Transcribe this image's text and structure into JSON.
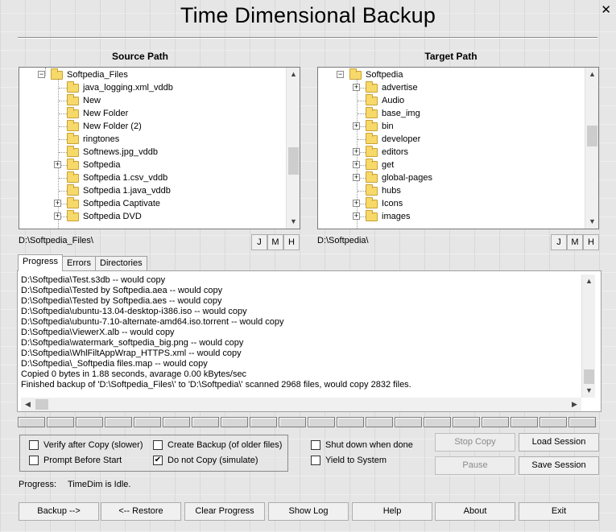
{
  "window": {
    "title": "Time Dimensional Backup",
    "close_glyph": "✕"
  },
  "source": {
    "header": "Source Path",
    "tree": {
      "root": "Softpedia_Files",
      "items": [
        {
          "label": "java_logging.xml_vddb",
          "expandable": false
        },
        {
          "label": "New",
          "expandable": false
        },
        {
          "label": "New Folder",
          "expandable": false
        },
        {
          "label": "New Folder (2)",
          "expandable": false
        },
        {
          "label": "ringtones",
          "expandable": false
        },
        {
          "label": "Softnews.jpg_vddb",
          "expandable": false
        },
        {
          "label": "Softpedia",
          "expandable": true
        },
        {
          "label": "Softpedia 1.csv_vddb",
          "expandable": false
        },
        {
          "label": "Softpedia 1.java_vddb",
          "expandable": false
        },
        {
          "label": "Softpedia Captivate",
          "expandable": true
        },
        {
          "label": "Softpedia DVD",
          "expandable": true
        }
      ]
    },
    "path": "D:\\Softpedia_Files\\",
    "buttons": {
      "j": "J",
      "m": "M",
      "h": "H"
    }
  },
  "target": {
    "header": "Target Path",
    "tree": {
      "root": "Softpedia",
      "items": [
        {
          "label": "advertise",
          "expandable": true
        },
        {
          "label": "Audio",
          "expandable": false
        },
        {
          "label": "base_img",
          "expandable": false
        },
        {
          "label": "bin",
          "expandable": true
        },
        {
          "label": "developer",
          "expandable": false
        },
        {
          "label": "editors",
          "expandable": true
        },
        {
          "label": "get",
          "expandable": true
        },
        {
          "label": "global-pages",
          "expandable": true
        },
        {
          "label": "hubs",
          "expandable": false
        },
        {
          "label": "Icons",
          "expandable": true
        },
        {
          "label": "images",
          "expandable": true
        }
      ]
    },
    "path": "D:\\Softpedia\\",
    "buttons": {
      "j": "J",
      "m": "M",
      "h": "H"
    }
  },
  "tabs": [
    {
      "label": "Progress",
      "active": true
    },
    {
      "label": "Errors",
      "active": false
    },
    {
      "label": "Directories",
      "active": false
    }
  ],
  "log": [
    "D:\\Softpedia\\Test.s3db -- would copy",
    "D:\\Softpedia\\Tested by Softpedia.aea -- would copy",
    "D:\\Softpedia\\Tested by Softpedia.aes -- would copy",
    "D:\\Softpedia\\ubuntu-13.04-desktop-i386.iso -- would copy",
    "D:\\Softpedia\\ubuntu-7.10-alternate-amd64.iso.torrent -- would copy",
    "D:\\Softpedia\\ViewerX.alb -- would copy",
    "D:\\Softpedia\\watermark_softpedia_big.png -- would copy",
    "D:\\Softpedia\\WhlFiltAppWrap_HTTPS.xml -- would copy",
    "D:\\Softpedia\\_Softpedia files.map -- would copy",
    "Copied 0 bytes in 1.88 seconds, avarage 0.00 kBytes/sec",
    "Finished backup of 'D:\\Softpedia_Files\\' to 'D:\\Softpedia\\' scanned 2968 files, would copy  2832 files."
  ],
  "progress_cells": 20,
  "options": {
    "verify": {
      "label": "Verify after Copy (slower)",
      "checked": false
    },
    "prompt": {
      "label": "Prompt Before Start",
      "checked": false
    },
    "create_backup": {
      "label": "Create Backup (of older files)",
      "checked": false
    },
    "do_not_copy": {
      "label": "Do not Copy (simulate)",
      "checked": true
    },
    "shutdown": {
      "label": "Shut down when done",
      "checked": false
    },
    "yield": {
      "label": "Yield to System",
      "checked": false
    }
  },
  "side_buttons": {
    "stop_copy": "Stop Copy",
    "pause": "Pause",
    "load_session": "Load Session",
    "save_session": "Save Session"
  },
  "status": {
    "label": "Progress:",
    "text": "TimeDim is Idle."
  },
  "bottom_buttons": {
    "backup": "Backup -->",
    "restore": "<-- Restore",
    "clear_progress": "Clear Progress",
    "show_log": "Show Log",
    "help": "Help",
    "about": "About",
    "exit": "Exit"
  },
  "check_glyph": "✔"
}
